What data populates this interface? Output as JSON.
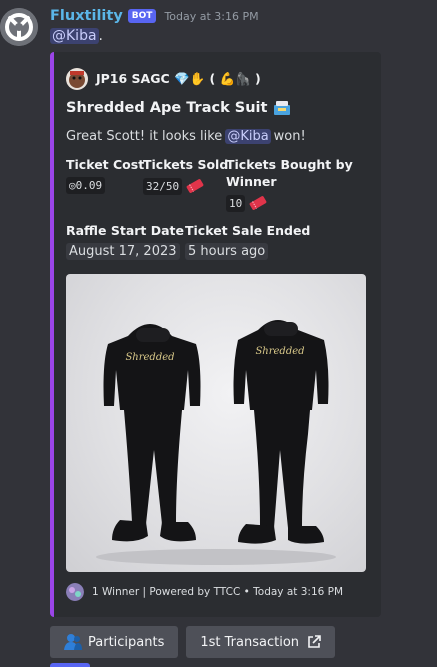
{
  "message": {
    "username": "Fluxtility",
    "bot_tag": "BOT",
    "timestamp": "Today at 3:16 PM",
    "mention": "@Kiba",
    "mention_suffix": "."
  },
  "embed": {
    "accent_color": "#9b45e8",
    "author": "JP16 SAGC 💎✋ ( 💪🦍 )",
    "title": "Shredded Ape Track Suit",
    "title_icon": "package-icon",
    "description_prefix": "Great Scott! it looks like",
    "description_mention": "@Kiba",
    "description_suffix": "won!",
    "fields": {
      "ticket_cost": {
        "name": "Ticket Cost",
        "value": "◎0.09"
      },
      "tickets_sold": {
        "name": "Tickets Sold",
        "value": "32/50"
      },
      "tickets_bought": {
        "name": "Tickets Bought by Winner",
        "value": "10"
      },
      "raffle_start": {
        "name": "Raffle Start Date",
        "value": "August 17, 2023"
      },
      "ticket_sale": {
        "name": "Ticket Sale Ended",
        "value": "5 hours ago"
      }
    },
    "image_alt": "Shredded Ape track suit",
    "image_text": "Shredded",
    "footer": "1 Winner | Powered by TTCC • Today at 3:16 PM"
  },
  "buttons": {
    "participants": "Participants",
    "first_transaction": "1st Transaction"
  }
}
